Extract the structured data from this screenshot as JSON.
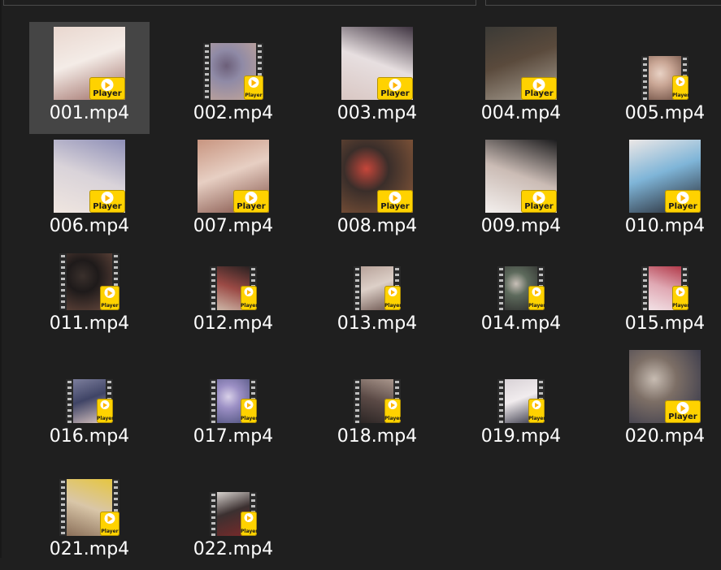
{
  "window": {
    "title": ""
  },
  "files": [
    {
      "name": "001.mp4",
      "selected": true,
      "thumb": "large",
      "colors": [
        "#e9d7cf",
        "#9c6a63",
        "#f4ece7"
      ]
    },
    {
      "name": "002.mp4",
      "selected": false,
      "thumb": "film-medium",
      "colors": [
        "#8f8aa6",
        "#c5a698",
        "#6c5f79"
      ]
    },
    {
      "name": "003.mp4",
      "selected": false,
      "thumb": "large",
      "colors": [
        "#e7dfe0",
        "#3f3441",
        "#d9c7c3"
      ]
    },
    {
      "name": "004.mp4",
      "selected": false,
      "thumb": "large",
      "colors": [
        "#3b3a36",
        "#a8a094",
        "#5a4a3c"
      ]
    },
    {
      "name": "005.mp4",
      "selected": false,
      "thumb": "film-small",
      "colors": [
        "#caa796",
        "#6a4b3f",
        "#e8d2c5"
      ]
    },
    {
      "name": "006.mp4",
      "selected": false,
      "thumb": "large",
      "colors": [
        "#d9d3d9",
        "#8e8fb7",
        "#f0e6e0"
      ]
    },
    {
      "name": "007.mp4",
      "selected": false,
      "thumb": "large",
      "colors": [
        "#c89580",
        "#7d4c42",
        "#e7cfc3"
      ]
    },
    {
      "name": "008.mp4",
      "selected": false,
      "thumb": "large",
      "colors": [
        "#3a2e2a",
        "#8c5a3a",
        "#c6463a"
      ]
    },
    {
      "name": "009.mp4",
      "selected": false,
      "thumb": "large",
      "colors": [
        "#cbbcb5",
        "#1c1c1e",
        "#f4f0ee"
      ]
    },
    {
      "name": "010.mp4",
      "selected": false,
      "thumb": "large",
      "colors": [
        "#ece7e6",
        "#23232b",
        "#7fb5d8"
      ]
    },
    {
      "name": "011.mp4",
      "selected": false,
      "thumb": "film-medium",
      "colors": [
        "#1e1a1a",
        "#6b4b3f",
        "#3a302c"
      ]
    },
    {
      "name": "012.mp4",
      "selected": false,
      "thumb": "film-small",
      "colors": [
        "#9b4a45",
        "#2a2222",
        "#cdb7a8"
      ]
    },
    {
      "name": "013.mp4",
      "selected": false,
      "thumb": "film-small",
      "colors": [
        "#b8a39a",
        "#6d5650",
        "#ddd0c8"
      ]
    },
    {
      "name": "014.mp4",
      "selected": false,
      "thumb": "film-small",
      "colors": [
        "#5d6a5c",
        "#2b2a2a",
        "#c9c0b8"
      ]
    },
    {
      "name": "015.mp4",
      "selected": false,
      "thumb": "film-small",
      "colors": [
        "#e0a9b4",
        "#b23a4a",
        "#f2e2e6"
      ]
    },
    {
      "name": "016.mp4",
      "selected": false,
      "thumb": "film-small",
      "colors": [
        "#7c7e9c",
        "#d9c4c0",
        "#3f4466"
      ]
    },
    {
      "name": "017.mp4",
      "selected": false,
      "thumb": "film-small",
      "colors": [
        "#9b8fc4",
        "#4b4f7a",
        "#d8d0e8"
      ]
    },
    {
      "name": "018.mp4",
      "selected": false,
      "thumb": "film-small",
      "colors": [
        "#5b4a46",
        "#a9968c",
        "#2c2625"
      ]
    },
    {
      "name": "019.mp4",
      "selected": false,
      "thumb": "film-small",
      "colors": [
        "#d8d2d6",
        "#3a3a4a",
        "#f1ecee"
      ]
    },
    {
      "name": "020.mp4",
      "selected": false,
      "thumb": "large",
      "colors": [
        "#7d6f66",
        "#2f3247",
        "#c7bcb2"
      ]
    },
    {
      "name": "021.mp4",
      "selected": false,
      "thumb": "film-medium",
      "colors": [
        "#d9c6a8",
        "#e6c640",
        "#8a6f59"
      ]
    },
    {
      "name": "022.mp4",
      "selected": false,
      "thumb": "film-small",
      "colors": [
        "#d9d4d0",
        "#7a2a2a",
        "#3b3030"
      ]
    }
  ],
  "colors": {
    "background": "#1f1f1f",
    "selection": "#454545",
    "text": "#ffffff",
    "badge": "#ffd200"
  },
  "badge_label": "Player",
  "icons": {
    "badge": "player-badge-icon",
    "play": "play-icon"
  }
}
